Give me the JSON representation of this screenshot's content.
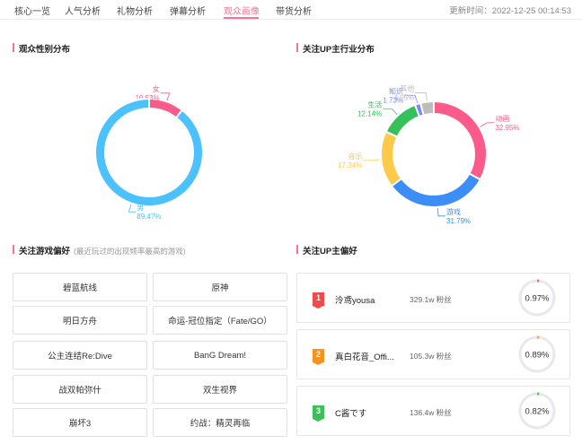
{
  "tabs": [
    {
      "label": "核心一览",
      "active": false
    },
    {
      "label": "人气分析",
      "active": false
    },
    {
      "label": "礼物分析",
      "active": false
    },
    {
      "label": "弹幕分析",
      "active": false
    },
    {
      "label": "观众画像",
      "active": true
    },
    {
      "label": "带货分析",
      "active": false
    }
  ],
  "updated_at": "更新时间：2022-12-25 00:14:53",
  "gender": {
    "title": "观众性别分布",
    "chart_data": {
      "type": "pie",
      "categories": [
        "女",
        "男"
      ],
      "values": [
        10.53,
        89.47
      ],
      "labels": [
        "10.53%",
        "89.47%"
      ],
      "colors": [
        "#fb5b8a",
        "#4cc1ff"
      ]
    }
  },
  "industry": {
    "title": "关注UP主行业分布",
    "chart_data": {
      "type": "pie",
      "categories": [
        "动画",
        "游戏",
        "音乐",
        "生活",
        "知识",
        "其他"
      ],
      "values": [
        32.95,
        31.79,
        17.34,
        12.14,
        1.73,
        4.05
      ],
      "labels": [
        "32.95%",
        "31.79%",
        "17.34%",
        "12.14%",
        "1.73%",
        "4.05%"
      ],
      "colors": [
        "#fb5b8a",
        "#3a8ef6",
        "#ffc94a",
        "#35c15a",
        "#7a86ff",
        "#bdbdbd"
      ]
    }
  },
  "games": {
    "title": "关注游戏偏好",
    "subtitle": "(最近玩过的出现频率最高的游戏)",
    "items": [
      "碧蓝航线",
      "原神",
      "明日方舟",
      "命运-冠位指定（Fate/GO）",
      "公主连结Re:Dive",
      "BanG Dream!",
      "战双帕弥什",
      "双生视界",
      "崩坏3",
      "约战：精灵再临"
    ]
  },
  "ups": {
    "title": "关注UP主偏好",
    "items": [
      {
        "rank": "1",
        "rank_color": "#f04a4a",
        "name": "泠鸢yousa",
        "fans": "329.1w 粉丝",
        "percent": "0.97%",
        "value": 0.97,
        "dot_color": "#f6706f"
      },
      {
        "rank": "2",
        "rank_color": "#f7931e",
        "name": "真白花音_Offi...",
        "fans": "105.3w 粉丝",
        "percent": "0.89%",
        "value": 0.89,
        "dot_color": "#f7a53a"
      },
      {
        "rank": "3",
        "rank_color": "#3fbf5a",
        "name": "C酱です",
        "fans": "136.4w 粉丝",
        "percent": "0.82%",
        "value": 0.82,
        "dot_color": "#4fc95f"
      }
    ]
  }
}
